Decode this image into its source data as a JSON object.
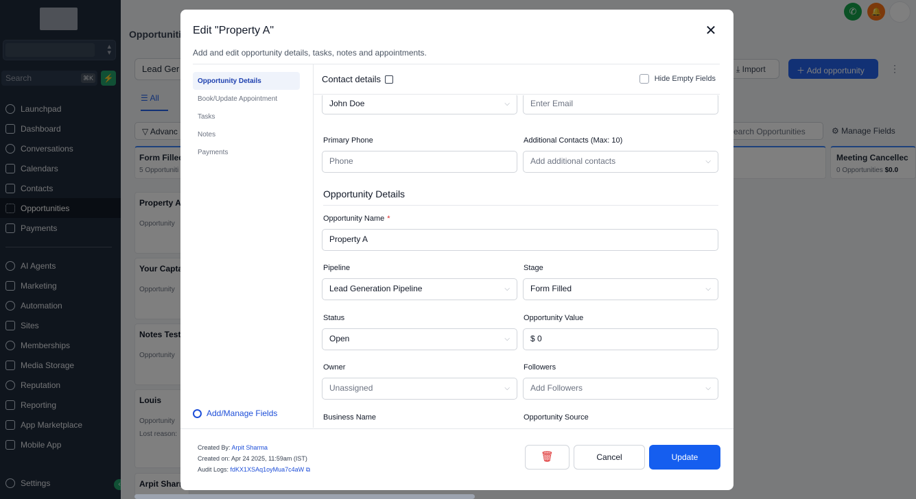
{
  "sidebar": {
    "search_placeholder": "Search",
    "search_shortcut": "⌘K",
    "items": [
      {
        "label": "Launchpad",
        "icon": "rocket-icon"
      },
      {
        "label": "Dashboard",
        "icon": "grid-icon"
      },
      {
        "label": "Conversations",
        "icon": "chat-icon"
      },
      {
        "label": "Calendars",
        "icon": "calendar-icon"
      },
      {
        "label": "Contacts",
        "icon": "contacts-icon"
      },
      {
        "label": "Opportunities",
        "icon": "opportunities-icon",
        "active": true
      },
      {
        "label": "Payments",
        "icon": "payments-icon"
      },
      {
        "label": "AI Agents",
        "icon": "sparkle-icon"
      },
      {
        "label": "Marketing",
        "icon": "send-icon"
      },
      {
        "label": "Automation",
        "icon": "automation-icon"
      },
      {
        "label": "Sites",
        "icon": "sites-icon"
      },
      {
        "label": "Memberships",
        "icon": "memberships-icon"
      },
      {
        "label": "Media Storage",
        "icon": "image-icon"
      },
      {
        "label": "Reputation",
        "icon": "star-icon"
      },
      {
        "label": "Reporting",
        "icon": "chart-icon"
      },
      {
        "label": "App Marketplace",
        "icon": "apps-icon"
      },
      {
        "label": "Mobile App",
        "icon": "mobile-icon"
      },
      {
        "label": "Settings",
        "icon": "gear-icon"
      }
    ]
  },
  "background": {
    "page_title": "Opportuniti",
    "pipeline_select": "Lead Ger",
    "tab_all": "All",
    "advanced_filters": "Advanc",
    "import_label": "Import",
    "add_opportunity_label": "Add opportunity",
    "search_opportunities": "earch Opportunities",
    "manage_fields": "Manage Fields",
    "column_form_filled": {
      "title": "Form Filled",
      "count": "5 Opportuniti"
    },
    "column_meeting_cancelled": {
      "title": "Meeting Cancellec",
      "count": "0 Opportunities",
      "value": "$0.0"
    },
    "cards": [
      {
        "title": "Property A",
        "sub": "Opportunity"
      },
      {
        "title": "Your Capta",
        "sub": "Opportunity"
      },
      {
        "title": "Notes Test",
        "sub": "Opportunity"
      },
      {
        "title": "Louis",
        "sub": "Opportunity"
      },
      {
        "title": "Arpit Sharn",
        "sub": ""
      }
    ],
    "louis_lost_reason": "Lost reason:"
  },
  "modal": {
    "title": "Edit \"Property A\"",
    "subtitle": "Add and edit opportunity details, tasks, notes and appointments.",
    "nav": [
      "Opportunity Details",
      "Book/Update Appointment",
      "Tasks",
      "Notes",
      "Payments"
    ],
    "add_manage_fields": "Add/Manage Fields",
    "contact_details_title": "Contact details",
    "hide_empty_fields": "Hide Empty Fields",
    "contact_name_value": "John Doe",
    "email_placeholder": "Enter Email",
    "primary_phone_label": "Primary Phone",
    "phone_placeholder": "Phone",
    "additional_contacts_label": "Additional Contacts (Max: 10)",
    "additional_contacts_placeholder": "Add additional contacts",
    "opportunity_details_title": "Opportunity Details",
    "opportunity_name_label": "Opportunity Name",
    "required_mark": "*",
    "opportunity_name_value": "Property A",
    "pipeline_label": "Pipeline",
    "pipeline_value": "Lead Generation Pipeline",
    "stage_label": "Stage",
    "stage_value": "Form Filled",
    "status_label": "Status",
    "status_value": "Open",
    "opportunity_value_label": "Opportunity Value",
    "opportunity_value": "$ 0",
    "owner_label": "Owner",
    "owner_value": "Unassigned",
    "followers_label": "Followers",
    "followers_placeholder": "Add Followers",
    "business_name_label": "Business Name",
    "opportunity_source_label": "Opportunity Source",
    "created_by_label": "Created By:",
    "created_by_value": "Arpit Sharma",
    "created_on": "Created on: Apr 24 2025, 11:59am (IST)",
    "audit_logs_label": "Audit Logs:",
    "audit_logs_value": "fdKX1XSAq1oyMua7c4aW",
    "cancel_label": "Cancel",
    "update_label": "Update"
  },
  "colors": {
    "primary": "#155eef",
    "sidebar": "#1e2a3b",
    "danger": "#dc2626"
  }
}
